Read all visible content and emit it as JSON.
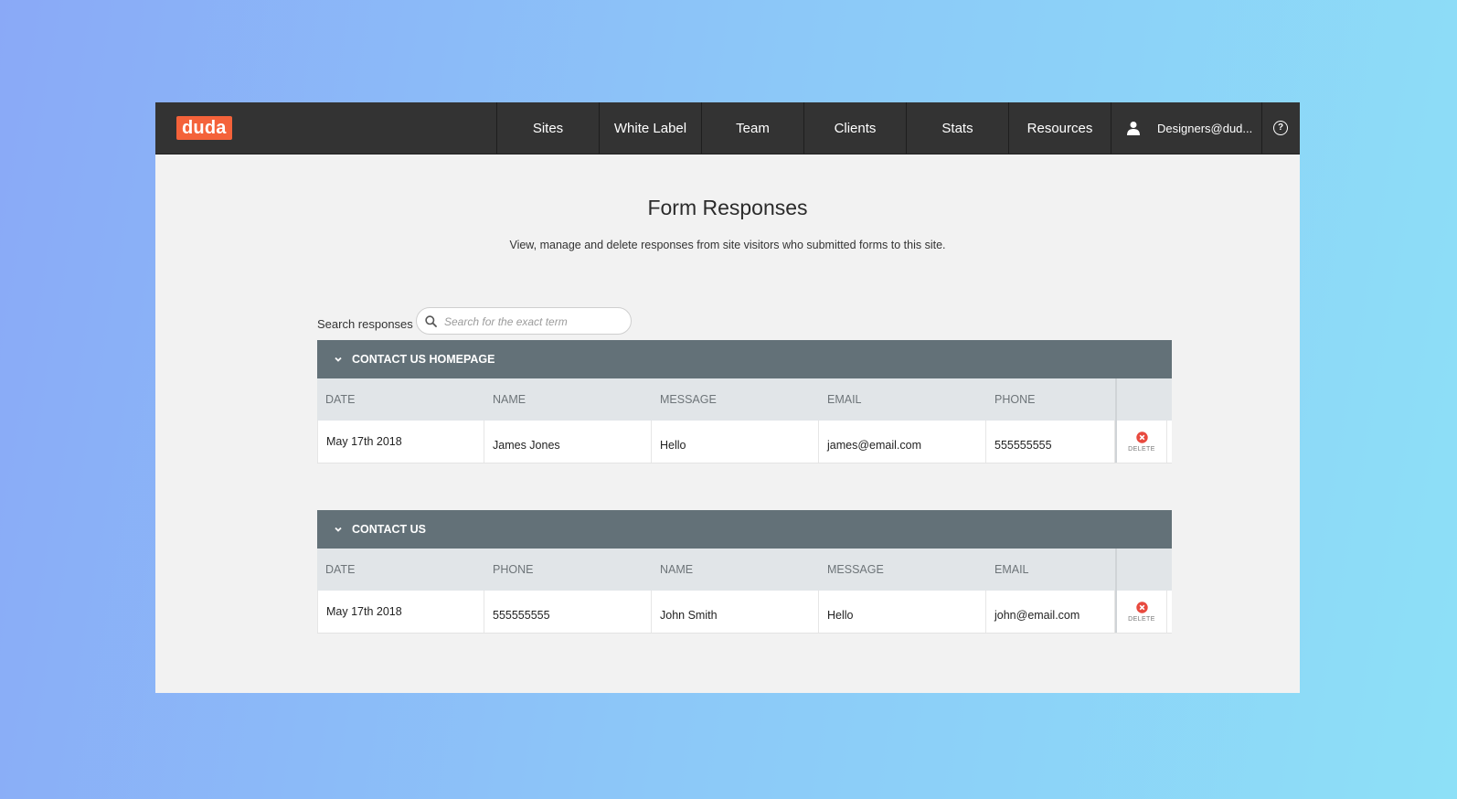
{
  "header": {
    "logo": "duda",
    "nav": [
      "Sites",
      "White Label",
      "Team",
      "Clients",
      "Stats",
      "Resources"
    ],
    "user": "Designers@dud...",
    "help_icon": "question-circle-icon"
  },
  "page": {
    "title": "Form Responses",
    "subtitle": "View, manage and delete responses from site visitors who submitted forms to this site."
  },
  "search": {
    "label": "Search responses",
    "placeholder": "Search for the exact term",
    "value": ""
  },
  "forms": [
    {
      "title": "CONTACT US HOMEPAGE",
      "columns": [
        "DATE",
        "NAME",
        "MESSAGE",
        "EMAIL",
        "PHONE"
      ],
      "rows": [
        [
          "May 17th 2018",
          "James Jones",
          "Hello",
          "james@email.com",
          "555555555"
        ]
      ],
      "delete_label": "DELETE"
    },
    {
      "title": "CONTACT US",
      "columns": [
        "DATE",
        "PHONE",
        "NAME",
        "MESSAGE",
        "EMAIL"
      ],
      "rows": [
        [
          "May 17th 2018",
          "555555555",
          "John Smith",
          "Hello",
          "john@email.com"
        ]
      ],
      "delete_label": "DELETE"
    }
  ],
  "colors": {
    "brand": "#f4623a",
    "topbar": "#333333",
    "group_header": "#637178",
    "delete": "#e84a3f"
  }
}
